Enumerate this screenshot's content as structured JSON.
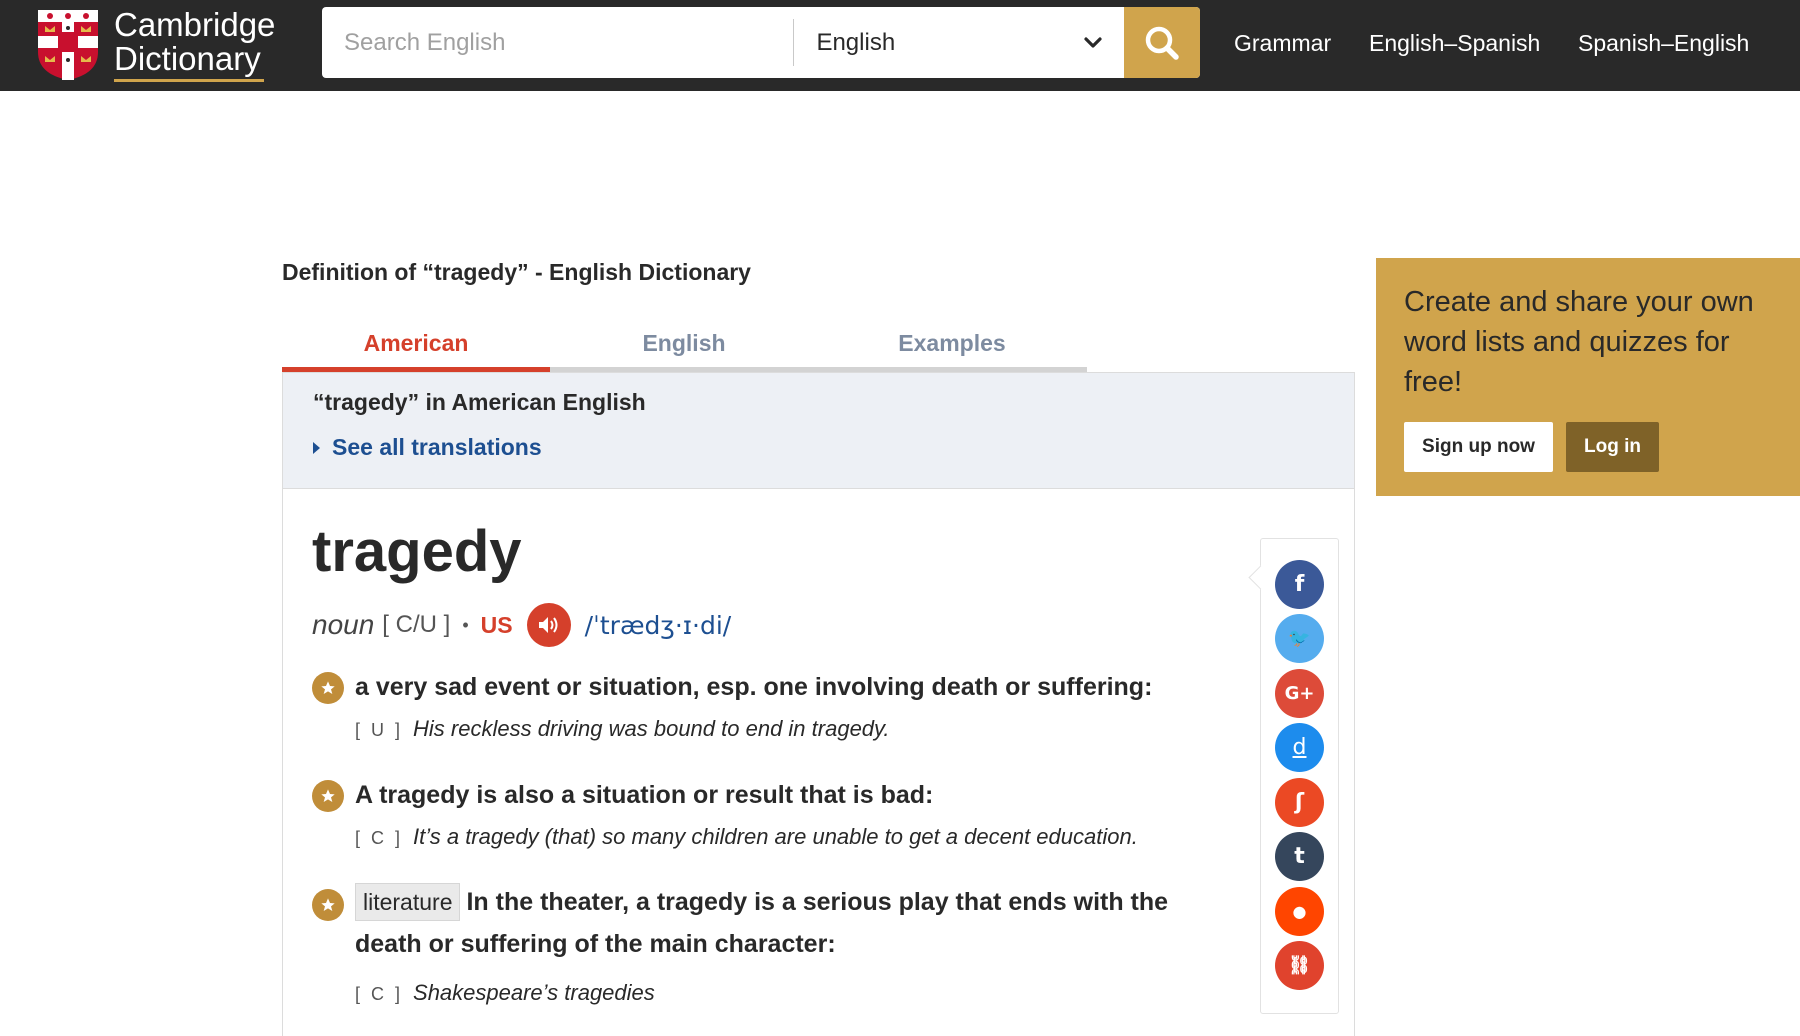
{
  "header": {
    "logo_line1": "Cambridge",
    "logo_line2": "Dictionary",
    "search_placeholder": "Search English",
    "language_selected": "English",
    "nav": [
      "Grammar",
      "English–Spanish",
      "Spanish–English"
    ]
  },
  "page": {
    "definition_title": "Definition of “tragedy” - English Dictionary",
    "tabs": [
      "American",
      "English",
      "Examples"
    ],
    "active_tab": "American",
    "panel_title": "“tragedy” in American English",
    "see_all": "See all translations"
  },
  "entry": {
    "headword": "tragedy",
    "pos": "noun",
    "grammar": "[ C/U ]",
    "separator": "•",
    "region": "US",
    "ipa": "/ˈtrædʒ·ɪ·di/",
    "senses": [
      {
        "definition": "a very sad event or situation, esp. one involving death or suffering:",
        "example_code": "[ U ]",
        "example": "His reckless driving was bound to end in tragedy."
      },
      {
        "definition": "A tragedy is also a situation or result that is bad:",
        "example_code": "[ C ]",
        "example": "It’s a tragedy (that) so many children are unable to get a decent education."
      },
      {
        "topic": "literature",
        "definition": "In the theater, a tragedy is a serious play that ends with the death or suffering of the main character:",
        "example_code": "[ C ]",
        "example": "Shakespeare’s tragedies"
      }
    ]
  },
  "share": {
    "icons": [
      "facebook-icon",
      "twitter-icon",
      "google-plus-icon",
      "delicious-icon",
      "stumbleupon-icon",
      "tumblr-icon",
      "reddit-icon",
      "link-icon"
    ],
    "glyphs": [
      "f",
      "🐦",
      "G+",
      "d",
      "ʃ",
      "t",
      "●",
      "⛓"
    ],
    "colors": [
      "#3b5998",
      "#55acee",
      "#dd4b39",
      "#1d8ced",
      "#eb4924",
      "#35465c",
      "#ff4500",
      "#e0432d"
    ]
  },
  "promo": {
    "text": "Create and share your own word lists and quizzes for free!",
    "signup": "Sign up now",
    "login": "Log in"
  },
  "colors": {
    "topbar": "#292929",
    "gold": "#d0a44c",
    "accent_red": "#d5402b",
    "link_blue": "#1d4f91"
  }
}
